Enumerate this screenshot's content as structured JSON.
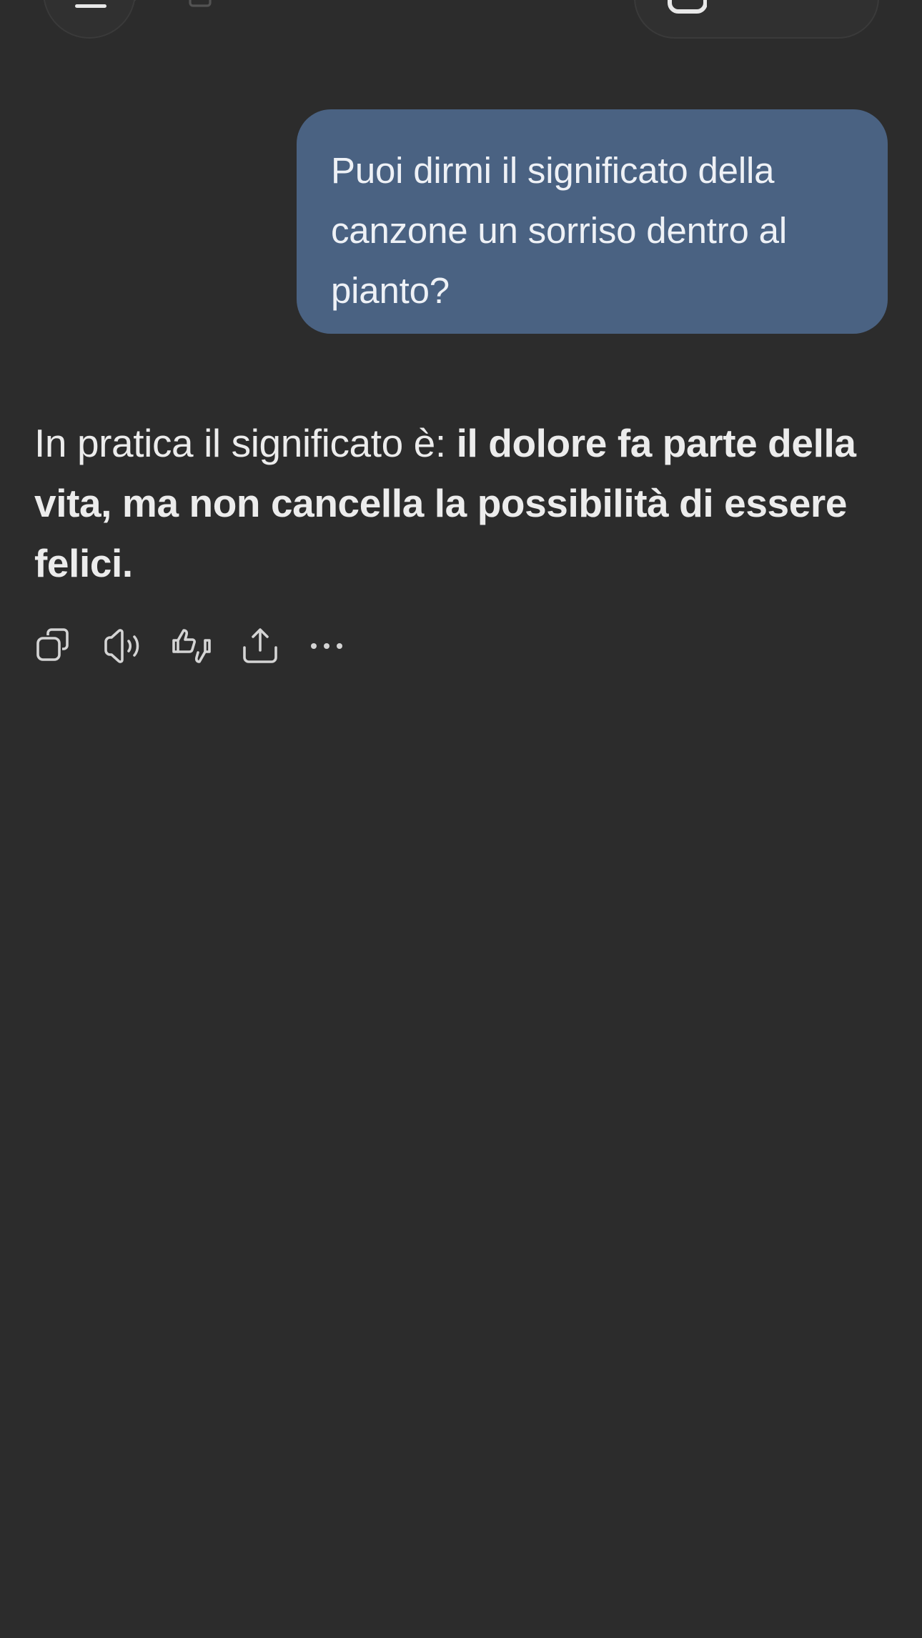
{
  "user_message": {
    "text": "Puoi dirmi il significato della canzone un sorriso dentro al pianto?"
  },
  "assistant_message": {
    "text_intro": "In pratica il significato è: ",
    "text_bold": "il dolore fa parte della vita, ma non cancella la possibilità di essere felici."
  },
  "actions": [
    {
      "icon": "copy-icon"
    },
    {
      "icon": "speaker-icon"
    },
    {
      "icon": "thumbs-up-down-icon"
    },
    {
      "icon": "share-icon"
    },
    {
      "icon": "more-icon"
    }
  ],
  "header": {
    "menu_icon": "menu-icon",
    "new_chat_icon": "edit-icon"
  },
  "colors": {
    "background": "#2c2c2c",
    "user_bubble": "#4a6282",
    "text": "#ececec"
  }
}
